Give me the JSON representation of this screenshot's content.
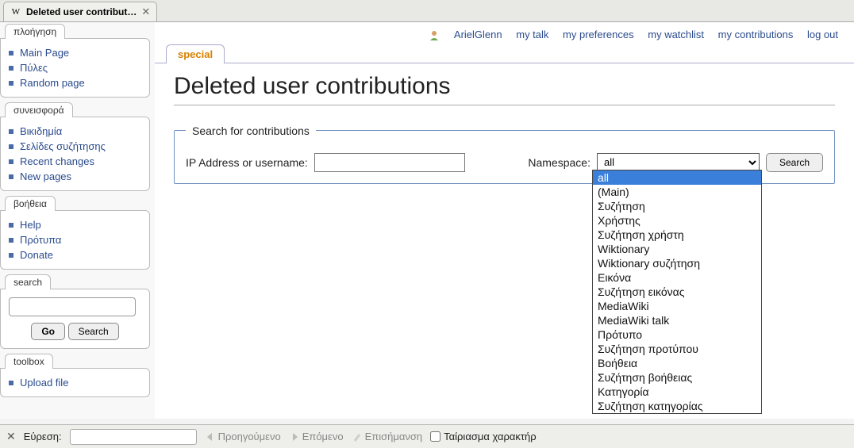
{
  "browserTab": {
    "title": "Deleted user contribut…",
    "favicon": "W"
  },
  "userLinks": {
    "username": "ArielGlenn",
    "talk": "my talk",
    "preferences": "my preferences",
    "watchlist": "my watchlist",
    "contributions": "my contributions",
    "logout": "log out"
  },
  "sidebar": {
    "nav": {
      "header": "πλοήγηση",
      "items": [
        "Main Page",
        "Πύλες",
        "Random page"
      ]
    },
    "contrib": {
      "header": "συνεισφορά",
      "items": [
        "Βικιδημία",
        "Σελίδες συζήτησης",
        "Recent changes",
        "New pages"
      ]
    },
    "help": {
      "header": "βοήθεια",
      "items": [
        "Help",
        "Πρότυπα",
        "Donate"
      ]
    },
    "search": {
      "header": "search",
      "go": "Go",
      "search": "Search"
    },
    "toolbox": {
      "header": "toolbox",
      "items": [
        "Upload file"
      ]
    }
  },
  "contentTab": "special",
  "pageTitle": "Deleted user contributions",
  "form": {
    "legend": "Search for contributions",
    "ipLabel": "IP Address or username:",
    "nsLabel": "Namespace:",
    "nsSelected": "all",
    "submit": "Search",
    "nsOptions": [
      "all",
      "(Main)",
      "Συζήτηση",
      "Χρήστης",
      "Συζήτηση χρήστη",
      "Wiktionary",
      "Wiktionary συζήτηση",
      "Εικόνα",
      "Συζήτηση εικόνας",
      "MediaWiki",
      "MediaWiki talk",
      "Πρότυπο",
      "Συζήτηση προτύπου",
      "Βοήθεια",
      "Συζήτηση βοήθειας",
      "Κατηγορία",
      "Συζήτηση κατηγορίας"
    ]
  },
  "findBar": {
    "label": "Εύρεση:",
    "prev": "Προηγούμενο",
    "next": "Επόμενο",
    "highlight": "Επισήμανση",
    "matchCase": "Ταίριασμα χαρακτήρ"
  }
}
